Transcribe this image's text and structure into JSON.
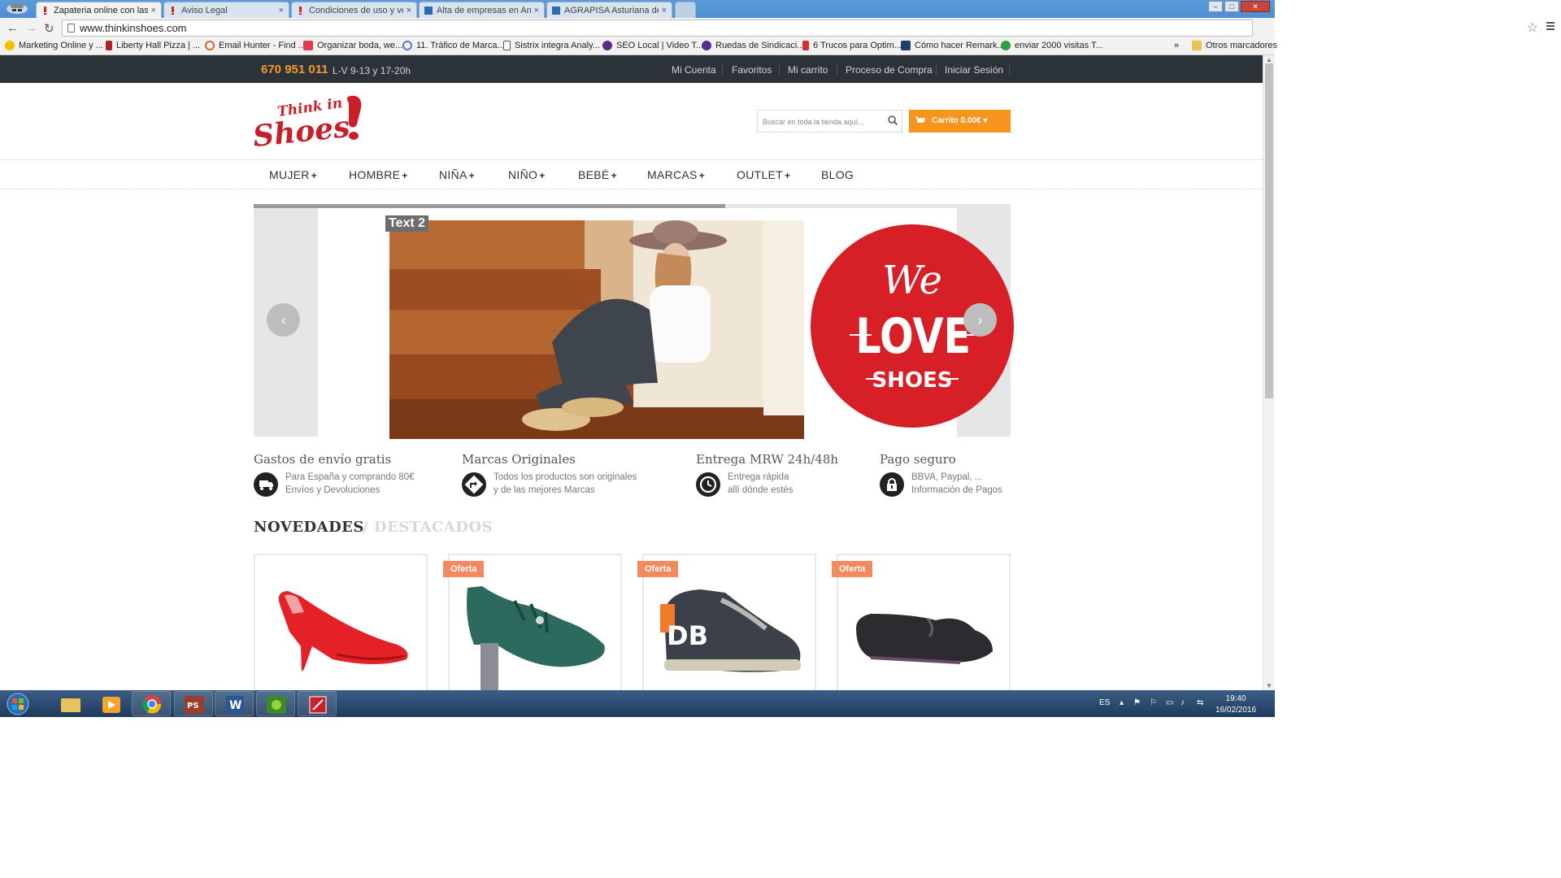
{
  "browser": {
    "tabs": [
      {
        "title": "Zapateria online con las m",
        "active": true
      },
      {
        "title": "Aviso Legal",
        "active": false
      },
      {
        "title": "Condiciones de uso y vent",
        "active": false
      },
      {
        "title": "Alta de empresas en Anua",
        "active": false
      },
      {
        "title": "AGRAPISA Asturiana de Ga",
        "active": false
      }
    ],
    "tab_close": "×",
    "url": "www.thinkinshoes.com",
    "star": "☆",
    "bookmarks": [
      "Marketing Online y ...",
      "Liberty Hall Pizza | ...",
      "Email Hunter - Find ...",
      "Organizar boda, we...",
      "11. Tráfico de Marca...",
      "Sistrix integra Analy...",
      "SEO Local | Video T...",
      "Ruedas de Sindicaci...",
      "6 Trucos para Optim...",
      "Cómo hacer Remark...",
      "enviar 2000 visitas T..."
    ],
    "bookmarks_more": "»",
    "other_bookmarks": "Otros marcadores"
  },
  "site": {
    "phone": "670 951 011",
    "hours": "L-V 9-13 y 17-20h",
    "top_links": [
      "Mi Cuenta",
      "Favoritos",
      "Mi carrito",
      "Proceso de Compra",
      "Iniciar Sesión"
    ],
    "logo": {
      "line1": "Think in",
      "line2": "Shoes"
    },
    "search_placeholder": "Buscar en toda la tienda aquí...",
    "cart_label": "Carrito 0.00€",
    "nav": [
      {
        "label": "MUJER",
        "plus": "+"
      },
      {
        "label": "HOMBRE",
        "plus": "+"
      },
      {
        "label": "NIÑA",
        "plus": "+"
      },
      {
        "label": "NIÑO",
        "plus": "+"
      },
      {
        "label": "BEBÉ",
        "plus": "+"
      },
      {
        "label": "MARCAS",
        "plus": "+"
      },
      {
        "label": "OUTLET",
        "plus": "+"
      },
      {
        "label": "BLOG",
        "plus": ""
      }
    ],
    "slider": {
      "caption": "Text 2",
      "badge_top": "We",
      "badge_mid": "LOVE",
      "badge_bottom": "SHOES",
      "prev": "‹",
      "next": "›"
    },
    "features": [
      {
        "title": "Gastos de envío gratis",
        "line1": "Para España y comprando 80€",
        "line2": "Envíos y Devoluciones",
        "icon": "truck-icon"
      },
      {
        "title": "Marcas Originales",
        "line1": "Todos los productos son originales",
        "line2": "y de las mejores Marcas",
        "icon": "arrow-turn-icon"
      },
      {
        "title": "Entrega MRW 24h/48h",
        "line1": "Entrega rápida",
        "line2": "allí dónde estés",
        "icon": "clock-icon"
      },
      {
        "title": "Pago seguro",
        "line1": "BBVA, Paypal, ...",
        "line2": "Información de Pagos",
        "icon": "lock-icon"
      }
    ],
    "tabs": {
      "active": "NOVEDADES",
      "inactive": "/ DESTACADOS"
    },
    "products": [
      {
        "badge": ""
      },
      {
        "badge": "Oferta"
      },
      {
        "badge": "Oferta"
      },
      {
        "badge": "Oferta"
      }
    ]
  },
  "taskbar": {
    "lang": "ES",
    "time": "19:40",
    "date": "16/02/2016"
  },
  "colors": {
    "accent": "#f7941d",
    "topbar": "#2c3338",
    "brand_red": "#d61f26",
    "oferta": "#f4895f"
  }
}
